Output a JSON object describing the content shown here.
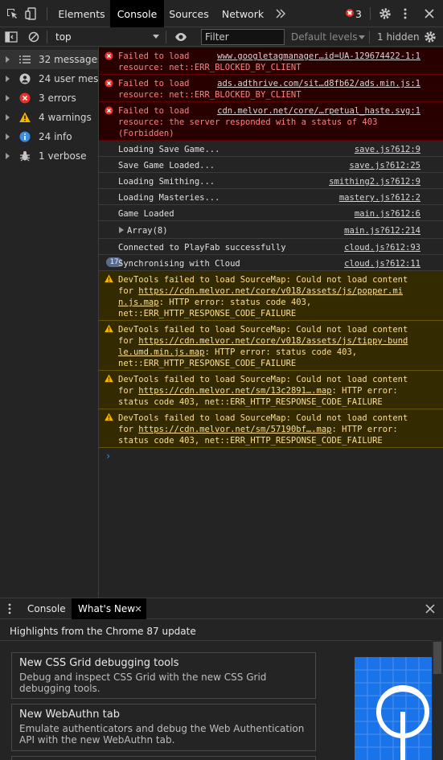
{
  "tabs": {
    "items": [
      {
        "label": "Elements"
      },
      {
        "label": "Console"
      },
      {
        "label": "Sources"
      },
      {
        "label": "Network"
      }
    ],
    "error_count": "3"
  },
  "toolbar": {
    "context": "top",
    "filter_placeholder": "Filter",
    "levels": "Default levels",
    "hidden": "1 hidden"
  },
  "sidebar": {
    "items": [
      {
        "label": "32 messages",
        "icon": "list-icon"
      },
      {
        "label": "24 user mes…",
        "icon": "user-icon"
      },
      {
        "label": "3 errors",
        "icon": "error-icon"
      },
      {
        "label": "4 warnings",
        "icon": "warning-icon"
      },
      {
        "label": "24 info",
        "icon": "info-icon"
      },
      {
        "label": "1 verbose",
        "icon": "bug-icon"
      }
    ]
  },
  "console": {
    "errors": [
      {
        "l1": "Failed to load",
        "src": "www.googletagmanager…id=UA-129674422-1:1",
        "l2": "resource: net::ERR_BLOCKED_BY_CLIENT",
        "l3": ""
      },
      {
        "l1": "Failed to load",
        "src": "ads.adthrive.com/sit…d8fb62/ads.min.js:1",
        "l2": "resource: net::ERR_BLOCKED_BY_CLIENT",
        "l3": ""
      },
      {
        "l1": "Failed to load",
        "src": "cdn.melvor.net/core/…rpetual_haste.svg:1",
        "l2": "resource: the server responded with a status of 403",
        "l3": "(Forbidden)"
      }
    ],
    "logs": [
      {
        "text": "Loading Save Game...",
        "src": "save.js?612:9"
      },
      {
        "text": "Save Game Loaded...",
        "src": "save.js?612:25"
      },
      {
        "text": "Loading Smithing...",
        "src": "smithing2.js?612:9"
      },
      {
        "text": "Loading Masteries...",
        "src": "mastery.js?612:2"
      },
      {
        "text": "Game Loaded",
        "src": "main.js?612:6"
      },
      {
        "text": "Array(8)",
        "src": "main.js?612:214"
      },
      {
        "text": "Connected to PlayFab successfully",
        "src": "cloud.js?612:93"
      },
      {
        "text": "Synchronising with Cloud",
        "src": "cloud.js?612:11",
        "count": "17"
      }
    ],
    "warnings": [
      {
        "l1": "DevTools failed to load SourceMap: Could not load content",
        "l2a": "for ",
        "link1": "https://cdn.melvor.net/core/v018/assets/js/popper.mi",
        "link2": "n.js.map",
        "l3rest": ": HTTP error: status code 403,",
        "l4": "net::ERR_HTTP_RESPONSE_CODE_FAILURE"
      },
      {
        "l1": "DevTools failed to load SourceMap: Could not load content",
        "l2a": "for ",
        "link1": "https://cdn.melvor.net/core/v018/assets/js/tippy-bund",
        "link2": "le.umd.min.js.map",
        "l3rest": ": HTTP error: status code 403,",
        "l4": "net::ERR_HTTP_RESPONSE_CODE_FAILURE"
      },
      {
        "l1": "DevTools failed to load SourceMap: Could not load content",
        "l2a": "for ",
        "link1": "https://cdn.melvor.net/sm/13c2891….map",
        "l2rest": ": HTTP error:",
        "l3": "status code 403, net::ERR_HTTP_RESPONSE_CODE_FAILURE"
      },
      {
        "l1": "DevTools failed to load SourceMap: Could not load content",
        "l2a": "for ",
        "link1": "https://cdn.melvor.net/sm/57190bf….map",
        "l2rest": ": HTTP error:",
        "l3": "status code 403, net::ERR_HTTP_RESPONSE_CODE_FAILURE"
      }
    ],
    "prompt": "›"
  },
  "drawer": {
    "tabs": [
      {
        "label": "Console"
      },
      {
        "label": "What's New"
      }
    ],
    "highlights": "Highlights from the Chrome 87 update",
    "cards": [
      {
        "title": "New CSS Grid debugging tools",
        "desc": "Debug and inspect CSS Grid with the new CSS Grid debugging tools."
      },
      {
        "title": "New WebAuthn tab",
        "desc": "Emulate authenticators and debug the Web Authentication API with the new WebAuthn tab."
      }
    ]
  },
  "colors": {
    "error_bg": "#290000",
    "error_text": "#ff8080",
    "warning_bg": "#332a00",
    "warning_text": "#fedf8d",
    "accent": "#1a73e8"
  }
}
